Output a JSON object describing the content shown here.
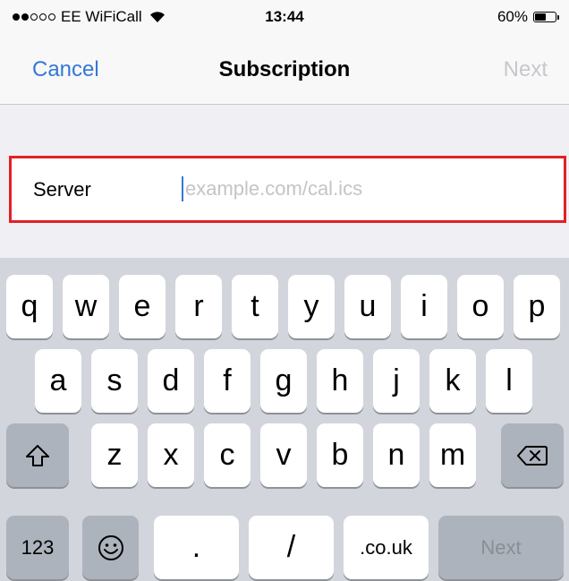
{
  "status_bar": {
    "carrier": "EE WiFiCall",
    "time": "13:44",
    "battery_percent": "60%",
    "battery_level": 0.6,
    "signal_bars_filled": 2,
    "signal_bars_total": 5
  },
  "nav": {
    "cancel_label": "Cancel",
    "title": "Subscription",
    "next_label": "Next"
  },
  "form": {
    "server_label": "Server",
    "server_value": "",
    "server_placeholder": "example.com/cal.ics",
    "highlight_color": "#e02124"
  },
  "keyboard": {
    "row1": [
      "q",
      "w",
      "e",
      "r",
      "t",
      "y",
      "u",
      "i",
      "o",
      "p"
    ],
    "row2": [
      "a",
      "s",
      "d",
      "f",
      "g",
      "h",
      "j",
      "k",
      "l"
    ],
    "row3": [
      "z",
      "x",
      "c",
      "v",
      "b",
      "n",
      "m"
    ],
    "numbers_label": "123",
    "dot_label": ".",
    "slash_label": "/",
    "domain_label": ".co.uk",
    "next_label": "Next",
    "icons": {
      "shift": "shift-icon",
      "backspace": "backspace-icon",
      "emoji": "emoji-icon"
    }
  },
  "colors": {
    "accent": "#3478d7",
    "disabled": "#c7c7cc",
    "keyboard_bg": "#d2d5db",
    "key_dark": "#adb3bc"
  }
}
